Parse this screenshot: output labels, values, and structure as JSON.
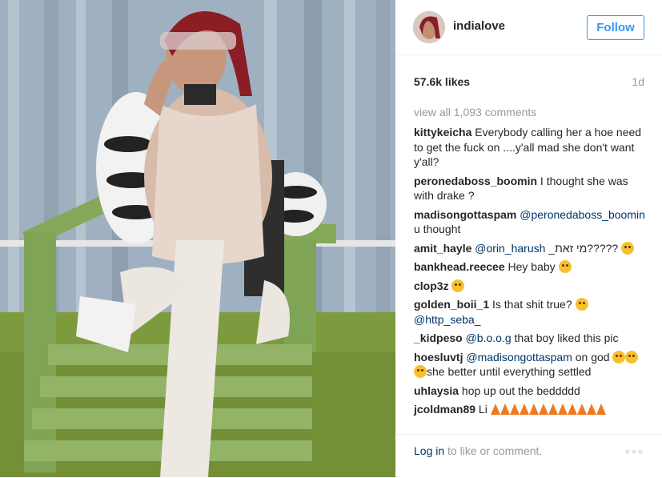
{
  "post": {
    "username": "indialove",
    "follow_label": "Follow",
    "likes": "57.6k likes",
    "time_ago": "1d",
    "view_all": "view all 1,093 comments"
  },
  "comments": [
    {
      "user": "kittykeicha",
      "text": "Everybody calling her a hoe need to get the fuck on ....y'all mad she don't want y'all?"
    },
    {
      "user": "peronedaboss_boomin",
      "text": "I thought she was with drake ?"
    },
    {
      "user": "madisongottaspam",
      "mention": "@peronedaboss_boomin",
      "text": "u thought"
    },
    {
      "user": "amit_hayle",
      "mention": "@orin_harush",
      "text": "_מי זאת?????"
    },
    {
      "user": "bankhead.reecee",
      "text": "Hey baby"
    },
    {
      "user": "clop3z",
      "text": ""
    },
    {
      "user": "golden_boii_1",
      "text": "Is that shit true?",
      "mention": "@http_seba_"
    },
    {
      "user": "_kidpeso",
      "mention": "@b.o.o.g",
      "text": "that boy liked this pic"
    },
    {
      "user": "hoesluvtj",
      "mention": "@madisongottaspam",
      "text": "on god",
      "text2": "she better until everything settled"
    },
    {
      "user": "uhlaysia",
      "text": "hop up out the beddddd"
    },
    {
      "user": "jcoldman89",
      "text": "Li"
    }
  ],
  "footer": {
    "login_link": "Log in",
    "login_rest": "to like or comment.",
    "more": "○○○"
  },
  "icons": {
    "emoji": "face-emoji-icon",
    "cone": "traffic-cone-icon"
  },
  "colors": {
    "accent": "#3897f0",
    "mention": "#003569",
    "muted": "#999999"
  }
}
